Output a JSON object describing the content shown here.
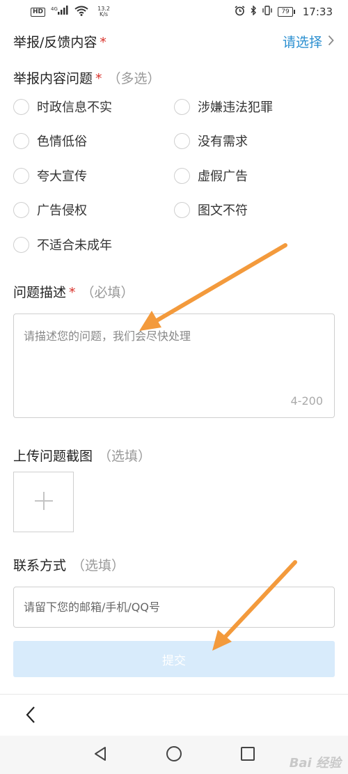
{
  "status_bar": {
    "hd": "HD",
    "network": "4G",
    "speed_value": "13.2",
    "speed_unit": "K/s",
    "battery": "79",
    "time": "17:33"
  },
  "report_content": {
    "label": "举报/反馈内容",
    "required_mark": "*",
    "select_label": "请选择"
  },
  "issues": {
    "label": "举报内容问题",
    "required_mark": "*",
    "hint": "（多选）",
    "options": [
      "时政信息不实",
      "涉嫌违法犯罪",
      "色情低俗",
      "没有需求",
      "夸大宣传",
      "虚假广告",
      "广告侵权",
      "图文不符",
      "不适合未成年"
    ]
  },
  "description": {
    "label": "问题描述",
    "required_mark": "*",
    "hint": "（必填）",
    "placeholder": "请描述您的问题，我们会尽快处理",
    "value": "",
    "counter": "4-200"
  },
  "screenshot": {
    "label": "上传问题截图",
    "hint": "（选填）"
  },
  "contact": {
    "label": "联系方式",
    "hint": "（选填）",
    "placeholder": "请留下您的邮箱/手机/QQ号",
    "value": ""
  },
  "submit": {
    "label": "提交"
  },
  "colors": {
    "accent": "#2b8fd0",
    "required": "#d9322b",
    "submit_bg": "#d8ebfb",
    "arrow": "#f39a3c"
  }
}
